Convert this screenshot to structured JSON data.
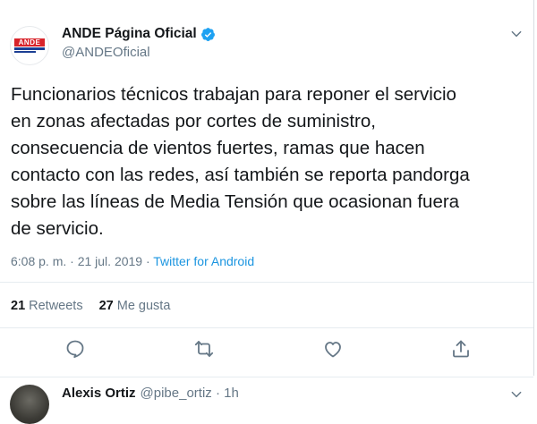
{
  "tweet": {
    "avatar_text": "ANDE",
    "display_name": "ANDE Página Oficial",
    "handle": "@ANDEOficial",
    "text": "Funcionarios técnicos trabajan para reponer el servicio\nen zonas afectadas por cortes de suministro,\nconsecuencia de vientos fuertes, ramas que hacen\ncontacto con las redes, así también se reporta pandorga\nsobre las líneas de Media Tensión que ocasionan fuera\nde servicio.",
    "timestamp": "6:08 p. m. · 21 jul. 2019 · ",
    "source": "Twitter for Android",
    "retweets_count": "21",
    "retweets_label": "Retweets",
    "likes_count": "27",
    "likes_label": "Me gusta"
  },
  "reply": {
    "display_name": "Alexis Ortiz",
    "handle_time": "@pibe_ortiz · 1h"
  },
  "colors": {
    "link": "#1b95e0",
    "secondary_text": "#657786",
    "brand_red": "#d8232a",
    "brand_blue": "#1c3f94"
  },
  "icons": [
    "verified-badge-icon",
    "chevron-down-icon",
    "reply-icon",
    "retweet-icon",
    "like-icon",
    "share-icon"
  ]
}
